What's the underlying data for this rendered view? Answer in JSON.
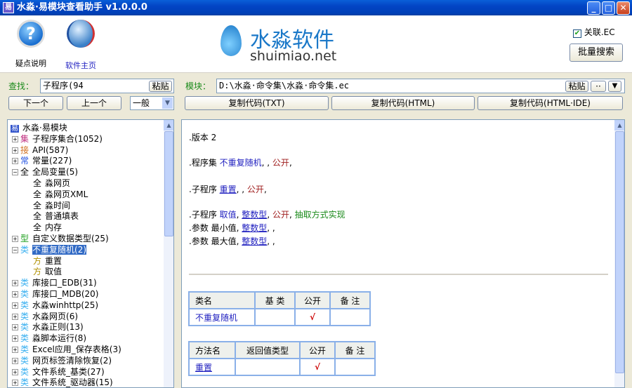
{
  "window": {
    "title": "水淼·易模块查看助手 v1.0.0.0",
    "app_icon": "app-icon",
    "minimize": "_",
    "maximize": "□",
    "close": "✕"
  },
  "header": {
    "help_label": "疑点说明",
    "home_label": "软件主页",
    "logo_text": "水淼软件",
    "logo_url": "shuimiao.net",
    "link_ec_label": "关联.EC",
    "link_ec_checked": true,
    "batch_search": "批量搜索"
  },
  "search": {
    "label": "查找：",
    "value": "子程序(94",
    "paste": "粘贴",
    "next": "下一个",
    "prev": "上一个",
    "mode": "一般"
  },
  "module": {
    "label": "模块：",
    "path": "D:\\水淼·命令集\\水淼·命令集.ec",
    "paste": "粘贴",
    "more": "··",
    "dropdown": "▼",
    "copy_txt": "复制代码(TXT)",
    "copy_html": "复制代码(HTML)",
    "copy_html_ide": "复制代码(HTML·IDE)"
  },
  "tree": [
    {
      "lvl": 0,
      "tag": "易",
      "tagc": "#3355cc",
      "label": "水淼·易模块"
    },
    {
      "lvl": 1,
      "pm": "+",
      "tag": "集",
      "tagc": "#c03080",
      "label": "子程序集合(1052)"
    },
    {
      "lvl": 1,
      "pm": "+",
      "tag": "接",
      "tagc": "#d07020",
      "label": "API(587)"
    },
    {
      "lvl": 1,
      "pm": "+",
      "tag": "常",
      "tagc": "#2050e0",
      "label": "常量(227)"
    },
    {
      "lvl": 1,
      "pm": "-",
      "tag": "全",
      "tagc": "#000",
      "label": "全局变量(5)"
    },
    {
      "lvl": 2,
      "tag": "全",
      "tagc": "#000",
      "label": "淼网页"
    },
    {
      "lvl": 2,
      "tag": "全",
      "tagc": "#000",
      "label": "淼网页XML"
    },
    {
      "lvl": 2,
      "tag": "全",
      "tagc": "#000",
      "label": "淼时间"
    },
    {
      "lvl": 2,
      "tag": "全",
      "tagc": "#000",
      "label": "普通填表"
    },
    {
      "lvl": 2,
      "tag": "全",
      "tagc": "#000",
      "label": "内存"
    },
    {
      "lvl": 1,
      "pm": "+",
      "tag": "型",
      "tagc": "#20a020",
      "label": "自定义数据类型(25)"
    },
    {
      "lvl": 1,
      "pm": "-",
      "tag": "类",
      "tagc": "#3ab0f0",
      "label": "不重复随机(2)",
      "selected": true
    },
    {
      "lvl": 2,
      "tag": "方",
      "tagc": "#b09000",
      "label": "重置"
    },
    {
      "lvl": 2,
      "tag": "方",
      "tagc": "#b09000",
      "label": "取值"
    },
    {
      "lvl": 1,
      "pm": "+",
      "tag": "类",
      "tagc": "#3ab0f0",
      "label": "库接口_EDB(31)"
    },
    {
      "lvl": 1,
      "pm": "+",
      "tag": "类",
      "tagc": "#3ab0f0",
      "label": "库接口_MDB(20)"
    },
    {
      "lvl": 1,
      "pm": "+",
      "tag": "类",
      "tagc": "#3ab0f0",
      "label": "水淼winhttp(25)"
    },
    {
      "lvl": 1,
      "pm": "+",
      "tag": "类",
      "tagc": "#3ab0f0",
      "label": "水淼网页(6)"
    },
    {
      "lvl": 1,
      "pm": "+",
      "tag": "类",
      "tagc": "#3ab0f0",
      "label": "水淼正则(13)"
    },
    {
      "lvl": 1,
      "pm": "+",
      "tag": "类",
      "tagc": "#3ab0f0",
      "label": "淼脚本运行(8)"
    },
    {
      "lvl": 1,
      "pm": "+",
      "tag": "类",
      "tagc": "#3ab0f0",
      "label": "Excel应用_保存表格(3)"
    },
    {
      "lvl": 1,
      "pm": "+",
      "tag": "类",
      "tagc": "#3ab0f0",
      "label": "网页标签清除恢复(2)"
    },
    {
      "lvl": 1,
      "pm": "+",
      "tag": "类",
      "tagc": "#3ab0f0",
      "label": "文件系统_基类(27)"
    },
    {
      "lvl": 1,
      "pm": "+",
      "tag": "类",
      "tagc": "#3ab0f0",
      "label": "文件系统_驱动器(15)"
    }
  ],
  "code": {
    "l1": {
      "a": ".版本 2"
    },
    "l2": {
      "a": ".程序集 ",
      "b": "不重复随机",
      "c": ", , ",
      "d": "公开",
      "e": ","
    },
    "l3": {
      "a": ".子程序 ",
      "b": "重置",
      "c": ", , ",
      "d": "公开",
      "e": ","
    },
    "l4": {
      "a": ".子程序 ",
      "b": "取值",
      "c": ", ",
      "t": "整数型",
      "c2": ", ",
      "d": "公开",
      "e": ", ",
      "f": "抽取方式实现"
    },
    "l5": {
      "a": ".参数 最小值, ",
      "t": "整数型",
      "e": ", ,"
    },
    "l6": {
      "a": ".参数 最大值, ",
      "t": "整数型",
      "e": ", ,"
    }
  },
  "class_table": {
    "headers": [
      "类名",
      "基 类",
      "公开",
      "备 注"
    ],
    "row": [
      "不重复随机",
      "",
      "√",
      ""
    ]
  },
  "method_table": {
    "headers": [
      "方法名",
      "返回值类型",
      "公开",
      "备 注"
    ],
    "row": [
      "重置",
      "",
      "√",
      ""
    ]
  }
}
